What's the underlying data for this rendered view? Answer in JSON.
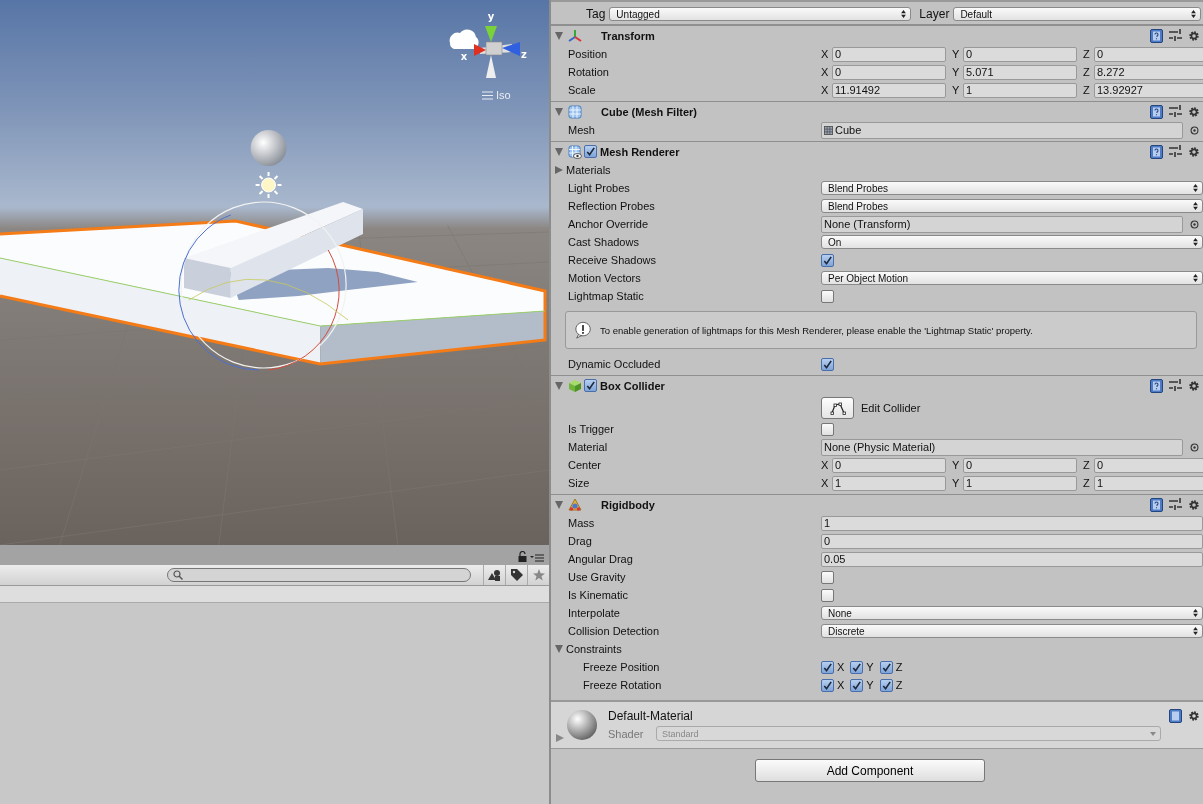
{
  "scene_view": {
    "gizmo": {
      "y_label": "y",
      "x_label": "x",
      "z_label": "z"
    },
    "projection": "Iso"
  },
  "inspector": {
    "tag": {
      "label": "Tag",
      "value": "Untagged"
    },
    "layer": {
      "label": "Layer",
      "value": "Default"
    },
    "components": [
      {
        "kind": "transform",
        "name": "Transform",
        "expanded": true,
        "rows": [
          {
            "kind": "vector3",
            "label": "Position",
            "axes": [
              {
                "axis": "X",
                "value": "0"
              },
              {
                "axis": "Y",
                "value": "0"
              },
              {
                "axis": "Z",
                "value": "0"
              }
            ]
          },
          {
            "kind": "vector3",
            "label": "Rotation",
            "axes": [
              {
                "axis": "X",
                "value": "0"
              },
              {
                "axis": "Y",
                "value": "5.071"
              },
              {
                "axis": "Z",
                "value": "8.272"
              }
            ]
          },
          {
            "kind": "vector3",
            "label": "Scale",
            "axes": [
              {
                "axis": "X",
                "value": "11.91492"
              },
              {
                "axis": "Y",
                "value": "1"
              },
              {
                "axis": "Z",
                "value": "13.92927"
              }
            ]
          }
        ]
      },
      {
        "kind": "mesh_filter",
        "name": "Cube (Mesh Filter)",
        "expanded": true,
        "rows": [
          {
            "kind": "mesh_object",
            "label": "Mesh",
            "value": "Cube"
          }
        ]
      },
      {
        "kind": "mesh_renderer",
        "name": "Mesh Renderer",
        "expanded": true,
        "enabled": true,
        "rows": [
          {
            "kind": "foldout",
            "label": "Materials",
            "expanded": false
          },
          {
            "kind": "dropdown",
            "label": "Light Probes",
            "value": "Blend Probes"
          },
          {
            "kind": "dropdown",
            "label": "Reflection Probes",
            "value": "Blend Probes"
          },
          {
            "kind": "object",
            "label": "Anchor Override",
            "value": "None (Transform)"
          },
          {
            "kind": "dropdown",
            "label": "Cast Shadows",
            "value": "On"
          },
          {
            "kind": "checkbox",
            "label": "Receive Shadows",
            "checked": true
          },
          {
            "kind": "dropdown",
            "label": "Motion Vectors",
            "value": "Per Object Motion"
          },
          {
            "kind": "checkbox",
            "label": "Lightmap Static",
            "checked": false
          },
          {
            "kind": "helpbox",
            "text": "To enable generation of lightmaps for this Mesh Renderer, please enable the 'Lightmap Static' property."
          },
          {
            "kind": "checkbox",
            "label": "Dynamic Occluded",
            "checked": true
          }
        ]
      },
      {
        "kind": "box_collider",
        "name": "Box Collider",
        "expanded": true,
        "enabled": true,
        "rows": [
          {
            "kind": "button",
            "label": "Edit Collider"
          },
          {
            "kind": "checkbox",
            "label": "Is Trigger",
            "checked": false
          },
          {
            "kind": "object",
            "label": "Material",
            "value": "None (Physic Material)"
          },
          {
            "kind": "vector3",
            "label": "Center",
            "axes": [
              {
                "axis": "X",
                "value": "0"
              },
              {
                "axis": "Y",
                "value": "0"
              },
              {
                "axis": "Z",
                "value": "0"
              }
            ]
          },
          {
            "kind": "vector3",
            "label": "Size",
            "axes": [
              {
                "axis": "X",
                "value": "1"
              },
              {
                "axis": "Y",
                "value": "1"
              },
              {
                "axis": "Z",
                "value": "1"
              }
            ]
          }
        ]
      },
      {
        "kind": "rigidbody",
        "name": "Rigidbody",
        "expanded": true,
        "rows": [
          {
            "kind": "text",
            "label": "Mass",
            "value": "1"
          },
          {
            "kind": "text",
            "label": "Drag",
            "value": "0"
          },
          {
            "kind": "text",
            "label": "Angular Drag",
            "value": "0.05"
          },
          {
            "kind": "checkbox",
            "label": "Use Gravity",
            "checked": false
          },
          {
            "kind": "checkbox",
            "label": "Is Kinematic",
            "checked": false
          },
          {
            "kind": "dropdown",
            "label": "Interpolate",
            "value": "None"
          },
          {
            "kind": "dropdown",
            "label": "Collision Detection",
            "value": "Discrete"
          },
          {
            "kind": "foldout",
            "label": "Constraints",
            "expanded": true,
            "children": [
              {
                "kind": "constraint",
                "label": "Freeze Position",
                "axes": [
                  {
                    "axis": "X",
                    "checked": true
                  },
                  {
                    "axis": "Y",
                    "checked": true
                  },
                  {
                    "axis": "Z",
                    "checked": true
                  }
                ]
              },
              {
                "kind": "constraint",
                "label": "Freeze Rotation",
                "axes": [
                  {
                    "axis": "X",
                    "checked": true
                  },
                  {
                    "axis": "Y",
                    "checked": true
                  },
                  {
                    "axis": "Z",
                    "checked": true
                  }
                ]
              }
            ]
          }
        ]
      }
    ],
    "material": {
      "name": "Default-Material",
      "shader_label": "Shader",
      "shader": "Standard"
    },
    "add_button": "Add Component"
  }
}
